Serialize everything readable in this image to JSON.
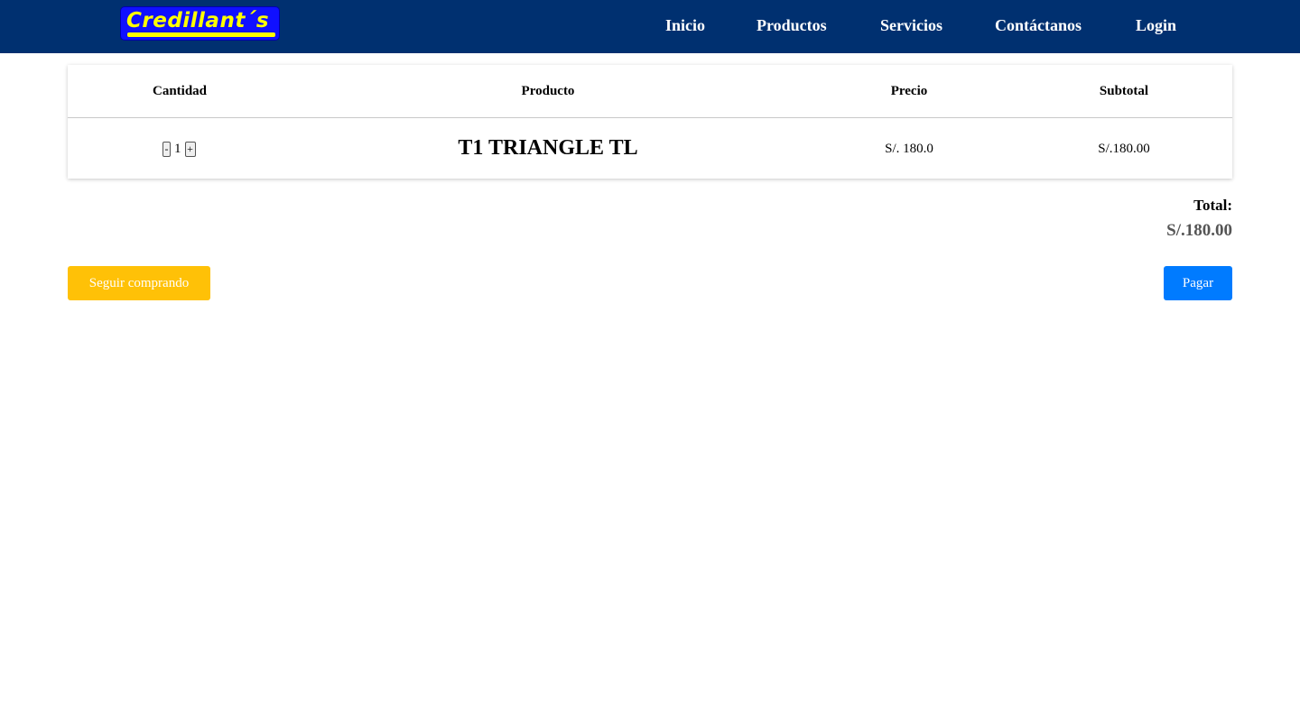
{
  "brand": {
    "logo_text": "Credillant´s"
  },
  "nav": {
    "items": [
      {
        "label": "Inicio"
      },
      {
        "label": "Productos"
      },
      {
        "label": "Servicios"
      },
      {
        "label": "Contáctanos"
      },
      {
        "label": "Login"
      }
    ]
  },
  "cart": {
    "headers": {
      "quantity": "Cantidad",
      "product": "Producto",
      "price": "Precio",
      "subtotal": "Subtotal"
    },
    "items": [
      {
        "decrement": "-",
        "quantity": "1",
        "increment": "+",
        "product": "T1 TRIANGLE TL",
        "price": "S/. 180.0",
        "subtotal": "S/.180.00"
      }
    ]
  },
  "summary": {
    "total_label": "Total:",
    "total_value": "S/.180.00"
  },
  "actions": {
    "continue_label": "Seguir comprando",
    "pay_label": "Pagar"
  },
  "colors": {
    "navbar": "#003070",
    "logo_bg": "#1010ff",
    "logo_text": "#ffff00",
    "continue_button": "#ffc107",
    "pay_button": "#007bff"
  }
}
